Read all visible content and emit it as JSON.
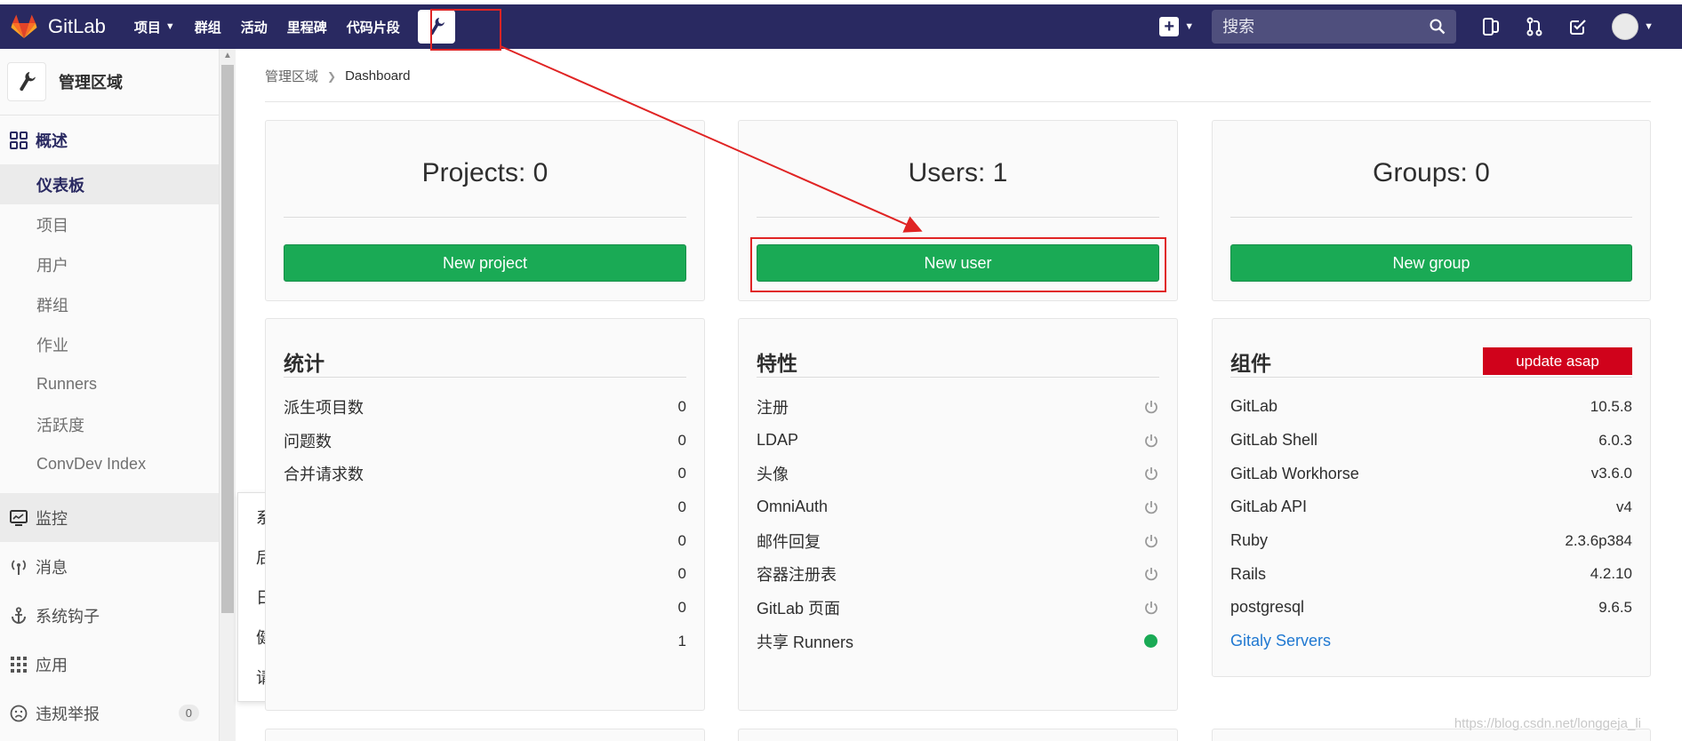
{
  "navbar": {
    "brand": "GitLab",
    "links": [
      {
        "label": "项目",
        "caret": true
      },
      {
        "label": "群组"
      },
      {
        "label": "活动"
      },
      {
        "label": "里程碑"
      },
      {
        "label": "代码片段"
      }
    ],
    "search_placeholder": "搜索"
  },
  "sidebar": {
    "title": "管理区域",
    "overview": "概述",
    "overview_items": [
      "仪表板",
      "项目",
      "用户",
      "群组",
      "作业",
      "Runners",
      "活跃度",
      "ConvDev Index"
    ],
    "items": [
      {
        "label": "监控",
        "icon": "monitor-icon"
      },
      {
        "label": "消息",
        "icon": "broadcast-icon"
      },
      {
        "label": "系统钩子",
        "icon": "anchor-icon"
      },
      {
        "label": "应用",
        "icon": "apps-icon"
      },
      {
        "label": "违规举报",
        "icon": "abuse-icon",
        "badge": "0"
      }
    ]
  },
  "flyout": {
    "items": [
      "系统信息",
      "后台作业",
      "日志",
      "健康检查",
      "请求配置"
    ]
  },
  "breadcrumb": {
    "parent": "管理区域",
    "current": "Dashboard"
  },
  "stats_cards": {
    "projects": {
      "title": "Projects: 0",
      "button": "New project"
    },
    "users": {
      "title": "Users: 1",
      "button": "New user"
    },
    "groups": {
      "title": "Groups: 0",
      "button": "New group"
    }
  },
  "statistics": {
    "heading": "统计",
    "rows": [
      {
        "label": "派生项目数",
        "value": "0"
      },
      {
        "label": "问题数",
        "value": "0"
      },
      {
        "label": "合并请求数",
        "value": "0"
      },
      {
        "label": "",
        "value": "0"
      },
      {
        "label": "",
        "value": "0"
      },
      {
        "label": "",
        "value": "0"
      },
      {
        "label": "",
        "value": "0"
      },
      {
        "label": "",
        "value": "1"
      }
    ]
  },
  "features": {
    "heading": "特性",
    "rows": [
      {
        "label": "注册",
        "state": "off"
      },
      {
        "label": "LDAP",
        "state": "off"
      },
      {
        "label": "头像",
        "state": "off"
      },
      {
        "label": "OmniAuth",
        "state": "off"
      },
      {
        "label": "邮件回复",
        "state": "off"
      },
      {
        "label": "容器注册表",
        "state": "off"
      },
      {
        "label": "GitLab 页面",
        "state": "off"
      },
      {
        "label": "共享 Runners",
        "state": "on"
      }
    ]
  },
  "components": {
    "heading": "组件",
    "badge": "update asap",
    "rows": [
      {
        "label": "GitLab",
        "value": "10.5.8"
      },
      {
        "label": "GitLab Shell",
        "value": "6.0.3"
      },
      {
        "label": "GitLab Workhorse",
        "value": "v3.6.0"
      },
      {
        "label": "GitLab API",
        "value": "v4"
      },
      {
        "label": "Ruby",
        "value": "2.3.6p384"
      },
      {
        "label": "Rails",
        "value": "4.2.10"
      },
      {
        "label": "postgresql",
        "value": "9.6.5"
      }
    ],
    "link": "Gitaly Servers"
  },
  "watermark": "https://blog.csdn.net/longgeja_li",
  "colors": {
    "navbar": "#292961",
    "green": "#1aaa55",
    "danger": "#d0021b",
    "annotation": "#e02424"
  }
}
